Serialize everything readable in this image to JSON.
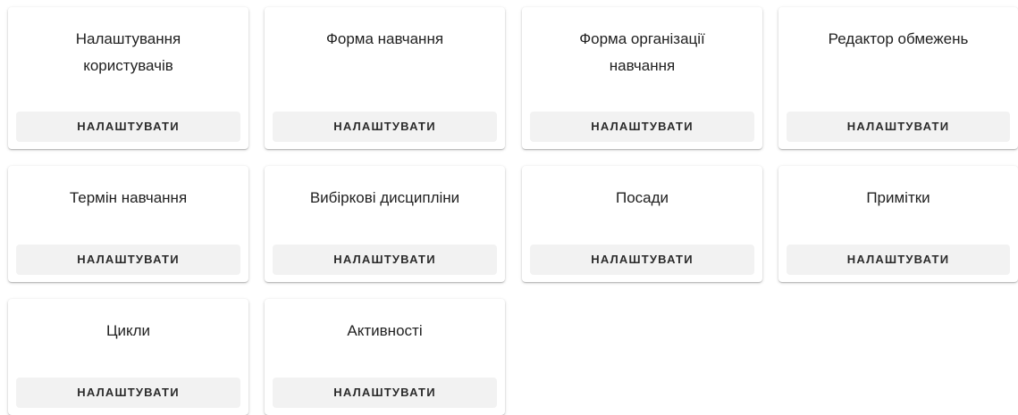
{
  "cards": [
    {
      "title_line1": "Налаштування",
      "title_line2": "користувачів",
      "button": "НАЛАШТУВАТИ"
    },
    {
      "title_line1": "Форма навчання",
      "title_line2": "",
      "button": "НАЛАШТУВАТИ"
    },
    {
      "title_line1": "Форма організації",
      "title_line2": "навчання",
      "button": "НАЛАШТУВАТИ"
    },
    {
      "title_line1": "Редактор обмежень",
      "title_line2": "",
      "button": "НАЛАШТУВАТИ"
    },
    {
      "title_line1": "Термін навчання",
      "title_line2": "",
      "button": "НАЛАШТУВАТИ"
    },
    {
      "title_line1": "Вибіркові дисципліни",
      "title_line2": "",
      "button": "НАЛАШТУВАТИ"
    },
    {
      "title_line1": "Посади",
      "title_line2": "",
      "button": "НАЛАШТУВАТИ"
    },
    {
      "title_line1": "Примітки",
      "title_line2": "",
      "button": "НАЛАШТУВАТИ"
    },
    {
      "title_line1": "Цикли",
      "title_line2": "",
      "button": "НАЛАШТУВАТИ"
    },
    {
      "title_line1": "Активності",
      "title_line2": "",
      "button": "НАЛАШТУВАТИ"
    }
  ]
}
